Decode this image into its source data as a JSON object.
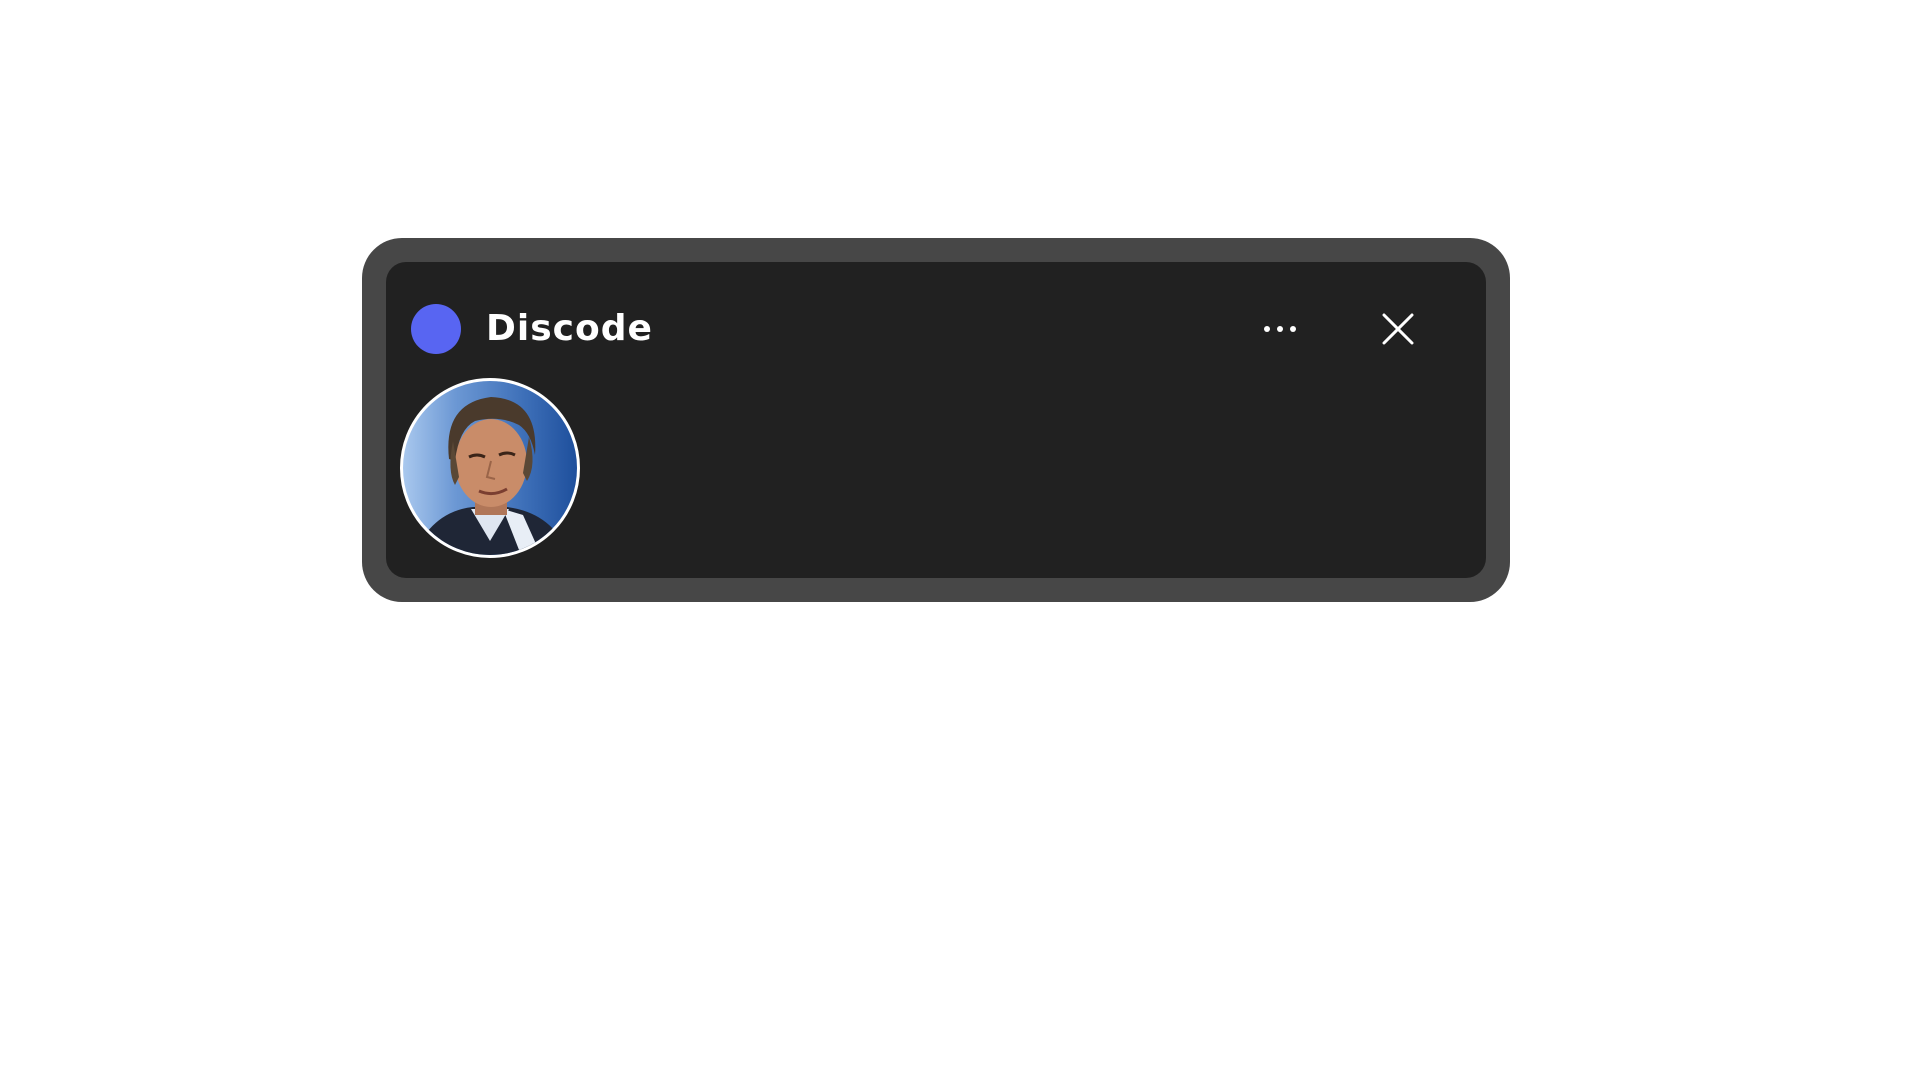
{
  "widget": {
    "app_title": "Discode",
    "logo_icon": "discord-logo-circle",
    "more_icon": "more-horizontal-icon",
    "close_icon": "close-icon",
    "accent_color": "#5865f2",
    "frame_color": "#474747",
    "panel_color": "#212121"
  },
  "participants": [
    {
      "avatar_icon": "user-avatar-photo"
    }
  ]
}
